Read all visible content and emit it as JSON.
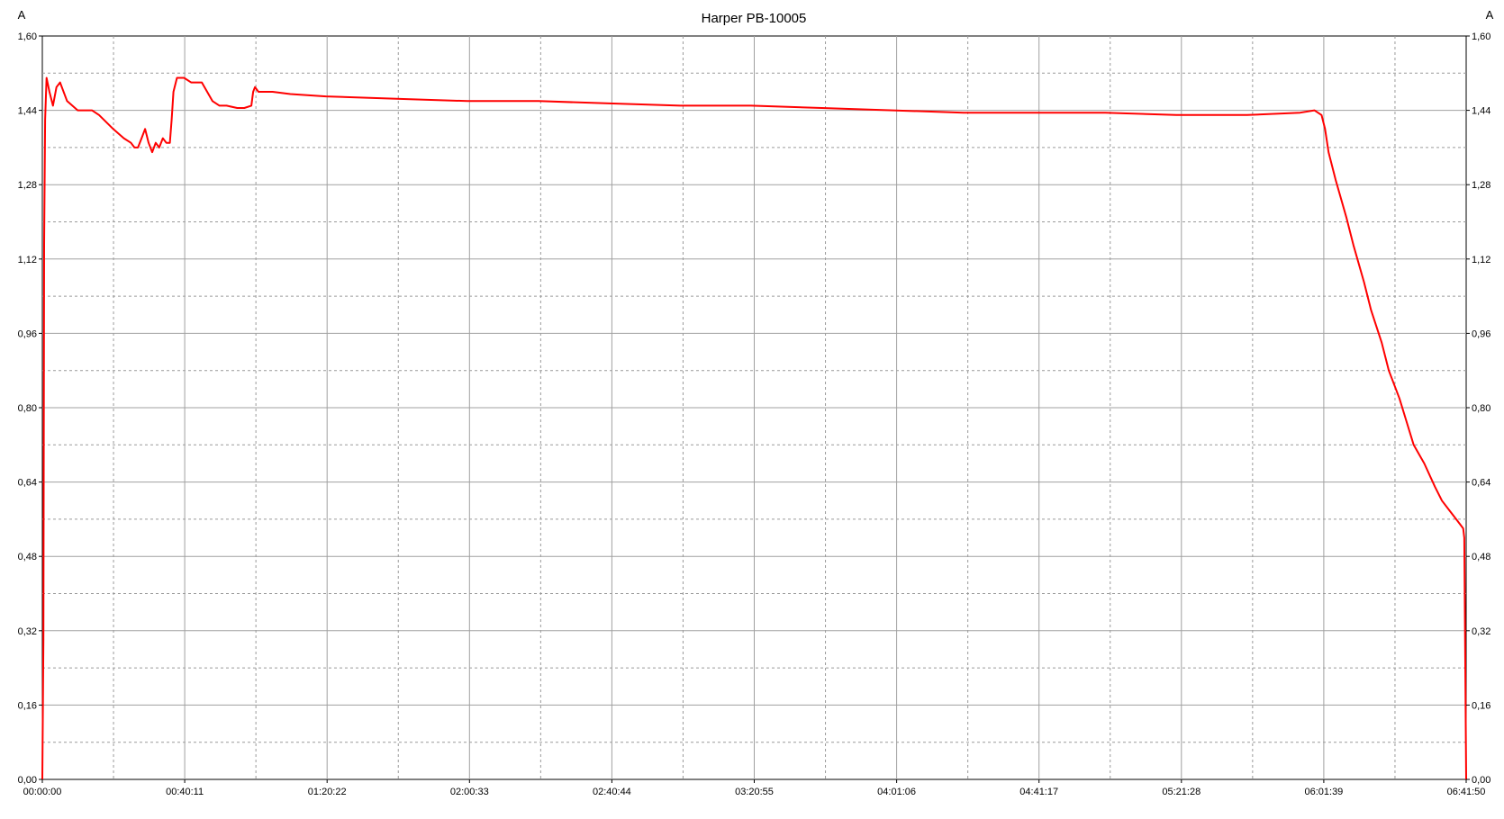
{
  "chart_data": {
    "type": "line",
    "title": "Harper PB-10005",
    "y_unit_left": "A",
    "y_unit_right": "A",
    "ylim": [
      0,
      1.6
    ],
    "yticks": [
      "0,00",
      "0,16",
      "0,32",
      "0,48",
      "0,64",
      "0,80",
      "0,96",
      "1,12",
      "1,28",
      "1,44",
      "1,60"
    ],
    "xticks": [
      "00:00:00",
      "00:40:11",
      "01:20:22",
      "02:00:33",
      "02:40:44",
      "03:20:55",
      "04:01:06",
      "04:41:17",
      "05:21:28",
      "06:01:39",
      "06:41:50"
    ],
    "xlim_minutes": [
      0,
      401.83
    ],
    "grid": true,
    "series": [
      {
        "color": "#ff0000",
        "x_minutes": [
          0,
          0.3,
          0.5,
          0.8,
          1.2,
          2,
          3,
          4,
          5,
          7,
          10,
          14,
          16,
          20,
          23,
          25,
          26,
          27,
          28,
          29,
          30,
          31,
          32,
          33,
          34,
          35,
          36,
          36.5,
          37,
          38,
          40,
          42,
          45,
          48,
          50,
          52,
          55,
          57,
          59,
          59.5,
          60,
          60.5,
          61,
          65,
          70,
          80,
          100,
          120,
          140,
          160,
          180,
          200,
          220,
          240,
          260,
          280,
          300,
          320,
          340,
          355,
          359,
          361,
          362,
          363,
          365,
          368,
          370,
          373,
          375,
          378,
          380,
          383,
          385,
          387,
          390,
          393,
          395,
          397,
          399,
          400.5,
          401,
          401.3,
          401.83
        ],
        "y": [
          0,
          0.3,
          1.15,
          1.42,
          1.51,
          1.48,
          1.45,
          1.49,
          1.5,
          1.46,
          1.44,
          1.44,
          1.43,
          1.4,
          1.38,
          1.37,
          1.36,
          1.36,
          1.38,
          1.4,
          1.37,
          1.35,
          1.37,
          1.36,
          1.38,
          1.37,
          1.37,
          1.42,
          1.48,
          1.51,
          1.51,
          1.5,
          1.5,
          1.46,
          1.45,
          1.45,
          1.445,
          1.445,
          1.45,
          1.48,
          1.49,
          1.485,
          1.48,
          1.48,
          1.475,
          1.47,
          1.465,
          1.46,
          1.46,
          1.455,
          1.45,
          1.45,
          1.445,
          1.44,
          1.435,
          1.435,
          1.435,
          1.43,
          1.43,
          1.435,
          1.44,
          1.43,
          1.4,
          1.35,
          1.29,
          1.21,
          1.15,
          1.07,
          1.01,
          0.94,
          0.88,
          0.82,
          0.77,
          0.72,
          0.68,
          0.63,
          0.6,
          0.58,
          0.56,
          0.545,
          0.54,
          0.52,
          0
        ]
      }
    ]
  }
}
